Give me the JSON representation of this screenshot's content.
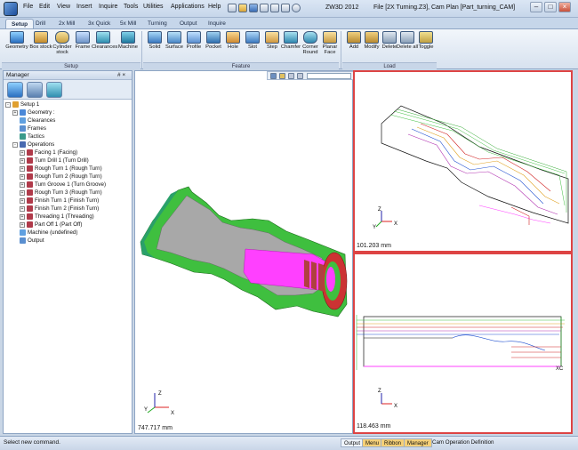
{
  "titlebar": {
    "app_name": "ZW3D 2012",
    "file_info": "File [2X Turning.Z3],  Cam Plan [Part_turning_CAM]"
  },
  "menu": [
    "File",
    "Edit",
    "View",
    "Insert",
    "Inquire",
    "Tools",
    "Utilities",
    "Applications",
    "Help"
  ],
  "tabs": [
    "Setup",
    "Drill",
    "2x Mill",
    "3x Quick",
    "5x Mill",
    "Turning",
    "Output",
    "Inquire"
  ],
  "ribbon": {
    "setup": [
      "Geometry",
      "Box stock",
      "Cylinder stock",
      "Frame",
      "Clearances",
      "Machine"
    ],
    "feature": [
      "Solid",
      "Surface",
      "Profile",
      "Pocket",
      "Hole",
      "Slot",
      "Step",
      "Chamfer",
      "Corner Round",
      "Planar Face"
    ],
    "load": [
      "Add",
      "Modify",
      "Delete",
      "Delete all",
      "Toggle"
    ],
    "groups": {
      "setup": "Setup",
      "feature": "Feature",
      "load": "Load"
    }
  },
  "manager": {
    "title": "Manager",
    "pin": "# ×",
    "tree": [
      {
        "label": "Setup 1",
        "level": 0,
        "exp": "-"
      },
      {
        "label": "Geometry :",
        "level": 1,
        "exp": "+"
      },
      {
        "label": "Clearances",
        "level": 1,
        "exp": ""
      },
      {
        "label": "Frames",
        "level": 1,
        "exp": ""
      },
      {
        "label": "Tactics",
        "level": 1,
        "exp": ""
      },
      {
        "label": "Operations",
        "level": 1,
        "exp": "-"
      },
      {
        "label": "Facing 1 (Facing)",
        "level": 2,
        "exp": "+"
      },
      {
        "label": "Turn Drill 1 (Turn Drill)",
        "level": 2,
        "exp": "+"
      },
      {
        "label": "Rough Turn 1 (Rough Turn)",
        "level": 2,
        "exp": "+"
      },
      {
        "label": "Rough Turn 2 (Rough Turn)",
        "level": 2,
        "exp": "+"
      },
      {
        "label": "Turn Groove 1 (Turn Groove)",
        "level": 2,
        "exp": "+"
      },
      {
        "label": "Rough Turn 3 (Rough Turn)",
        "level": 2,
        "exp": "+"
      },
      {
        "label": "Finish Turn 1 (Finish Turn)",
        "level": 2,
        "exp": "+"
      },
      {
        "label": "Finish Turn 2 (Finish Turn)",
        "level": 2,
        "exp": "+"
      },
      {
        "label": "Threading 1 (Threading)",
        "level": 2,
        "exp": "+"
      },
      {
        "label": "Part Off 1 (Part Off)",
        "level": 2,
        "exp": "+"
      },
      {
        "label": "Machine (undefined)",
        "level": 1,
        "exp": ""
      },
      {
        "label": "Output",
        "level": 1,
        "exp": ""
      }
    ]
  },
  "viewports": {
    "main_measure": "747.717 mm",
    "top_right_measure": "101.203 mm",
    "bottom_right_measure": "118.463 mm",
    "axis_x": "X",
    "axis_y": "Y",
    "axis_z": "Z",
    "axis_xc": "XC"
  },
  "status": {
    "message": "Select new command.",
    "tabs": [
      "Output",
      "Menu",
      "Ribbon",
      "Manager"
    ],
    "right_text": "Cam Operation Definition"
  },
  "colors": {
    "accent": "#f0c060",
    "ribbon": "#dbe6f4",
    "part_green": "#3fbf3f",
    "part_gray": "#a8a8a8",
    "bore_magenta": "#ff40ff",
    "viewport_border": "#d44444"
  }
}
